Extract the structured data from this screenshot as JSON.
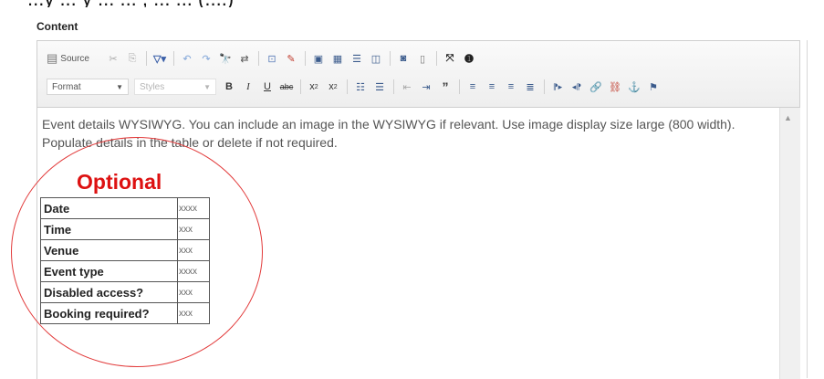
{
  "header": {
    "partial_text": "...y ... y ... ... , ... ... (....)"
  },
  "section_label": "Content",
  "toolbar": {
    "source_label": "Source",
    "format_label": "Format",
    "styles_label": "Styles"
  },
  "body_text": "Event details WYSIWYG. You can include an image in the WYSIWYG if relevant. Use image display size large (800 width). Populate details in the table or delete if not required.",
  "annotation": {
    "label": "Optional",
    "color": "#dd1111"
  },
  "table": {
    "rows": [
      {
        "label": "Date",
        "value": "xxxx"
      },
      {
        "label": "Time",
        "value": "xxx"
      },
      {
        "label": "Venue",
        "value": "xxx"
      },
      {
        "label": "Event type",
        "value": "xxxx"
      },
      {
        "label": "Disabled access?",
        "value": "xxx"
      },
      {
        "label": "Booking required?",
        "value": "xxx"
      }
    ]
  }
}
